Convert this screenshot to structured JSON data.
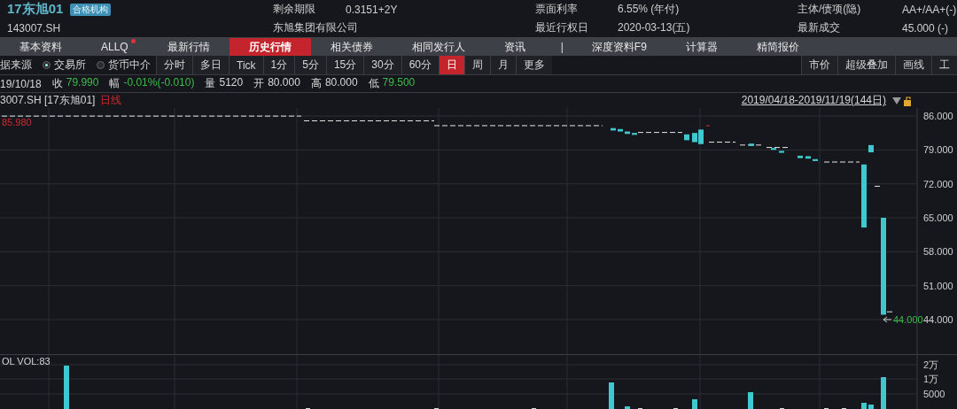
{
  "bond": {
    "name": "17东旭01",
    "badge": "合格机构",
    "code": "143007.SH",
    "issuer": "东旭集团有限公司",
    "fields": [
      {
        "label": "剩余期限",
        "value": "0.3151+2Y"
      },
      {
        "label": "票面利率",
        "value": "6.55% (年付)"
      },
      {
        "label": "主体/债项(隐)",
        "value": "AA+/AA+(-)"
      },
      {
        "label": "最近行权日",
        "value": "2020-03-13(五)"
      },
      {
        "label": "最新成交",
        "value": "45.000  (-)"
      }
    ]
  },
  "tabs": [
    {
      "kind": "tab",
      "label": "基本资料",
      "selected": false,
      "notify": false
    },
    {
      "kind": "tab",
      "label": "ALLQ",
      "selected": false,
      "notify": true
    },
    {
      "kind": "tab",
      "label": "最新行情",
      "selected": false,
      "notify": false
    },
    {
      "kind": "tab",
      "label": "历史行情",
      "selected": true,
      "notify": false
    },
    {
      "kind": "tab",
      "label": "相关债券",
      "selected": false,
      "notify": false
    },
    {
      "kind": "tab",
      "label": "相同发行人",
      "selected": false,
      "notify": false
    },
    {
      "kind": "tab",
      "label": "资讯",
      "selected": false,
      "notify": false
    },
    {
      "kind": "separator",
      "label": "|"
    },
    {
      "kind": "tab",
      "label": "深度资料F9",
      "selected": false,
      "notify": false
    },
    {
      "kind": "tab",
      "label": "计算器",
      "selected": false,
      "notify": false
    },
    {
      "kind": "tab",
      "label": "精简报价",
      "selected": false,
      "notify": false
    }
  ],
  "toolbar": {
    "source_label": "据来源",
    "sources": [
      {
        "label": "交易所",
        "selected": true
      },
      {
        "label": "货币中介",
        "selected": false
      }
    ],
    "periods": [
      {
        "label": "分时",
        "selected": false
      },
      {
        "label": "多日",
        "selected": false
      },
      {
        "label": "Tick",
        "selected": false
      },
      {
        "label": "1分",
        "selected": false
      },
      {
        "label": "5分",
        "selected": false
      },
      {
        "label": "15分",
        "selected": false
      },
      {
        "label": "30分",
        "selected": false
      },
      {
        "label": "60分",
        "selected": false
      },
      {
        "label": "日",
        "selected": true
      },
      {
        "label": "周",
        "selected": false
      },
      {
        "label": "月",
        "selected": false
      },
      {
        "label": "更多",
        "selected": false
      }
    ],
    "tools": [
      "市价",
      "超级叠加",
      "画线",
      "工"
    ]
  },
  "quote": {
    "date": "19/10/18",
    "items": [
      {
        "label": "收",
        "value": "79.990",
        "falling": true
      },
      {
        "label": "幅",
        "value": "-0.01%(-0.010)",
        "falling": true
      },
      {
        "label": "量",
        "value": "5120",
        "falling": false
      },
      {
        "label": "开",
        "value": "80.000",
        "falling": false
      },
      {
        "label": "高",
        "value": "80.000",
        "falling": false
      },
      {
        "label": "低",
        "value": "79.500",
        "falling": true
      }
    ]
  },
  "chart": {
    "title": "3007.SH [17东旭01]",
    "period": "日线",
    "range": "2019/04/18-2019/11/19(144日)",
    "yticks": [
      "86.000",
      "79.000",
      "72.000",
      "65.000",
      "58.000",
      "51.000",
      "44.000"
    ],
    "max_label": "85.980",
    "min_label": "44.000",
    "volume_title": "OL VOL:83",
    "volume_ticks": [
      "2万",
      "1万",
      "5000"
    ]
  }
}
